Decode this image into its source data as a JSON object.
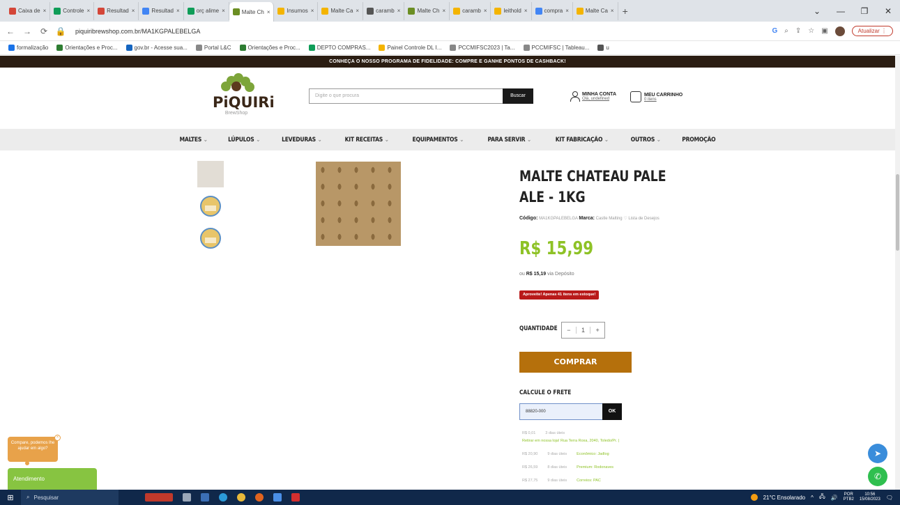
{
  "browser": {
    "tabs": [
      {
        "label": "Caixa de",
        "color": "#d44638"
      },
      {
        "label": "Controle",
        "color": "#0f9d58"
      },
      {
        "label": "Resultad",
        "color": "#d44638"
      },
      {
        "label": "Resultad",
        "color": "#4285f4"
      },
      {
        "label": "orç alime",
        "color": "#0f9d58"
      },
      {
        "label": "Malte Ch",
        "color": "#6b8e23",
        "active": true
      },
      {
        "label": "Insumos",
        "color": "#f4b400"
      },
      {
        "label": "Malte Ca",
        "color": "#f4b400"
      },
      {
        "label": "caramb",
        "color": "#555555"
      },
      {
        "label": "Malte Ch",
        "color": "#6b8e23"
      },
      {
        "label": "caramb",
        "color": "#f4b400"
      },
      {
        "label": "leithold",
        "color": "#f4b400"
      },
      {
        "label": "compra",
        "color": "#4285f4"
      },
      {
        "label": "Malte Ca",
        "color": "#f4b400"
      }
    ],
    "new_tab": "+",
    "url": "piquiribrewshop.com.br/MA1KGPALEBELGA",
    "update_label": "Atualizar",
    "bookmarks": [
      {
        "label": "formalização",
        "color": "#1a73e8"
      },
      {
        "label": "Orientações e Proc...",
        "color": "#2e7d32"
      },
      {
        "label": "gov.br - Acesse sua...",
        "color": "#1565c0"
      },
      {
        "label": "Portal L&C",
        "color": "#888888"
      },
      {
        "label": "Orientações e Proc...",
        "color": "#2e7d32"
      },
      {
        "label": "DEPTO COMPRAS...",
        "color": "#0f9d58"
      },
      {
        "label": "Painel Controle DL I...",
        "color": "#f4b400"
      },
      {
        "label": "PCCMIFSC2023 | Ta...",
        "color": "#888888"
      },
      {
        "label": "PCCMIFSC | Tableau...",
        "color": "#888888"
      },
      {
        "label": "u",
        "color": "#555555"
      }
    ]
  },
  "site": {
    "promo_bar": "CONHEÇA O NOSSO PROGRAMA DE FIDELIDADE: COMPRE E GANHE PONTOS DE CASHBACK!",
    "logo_name": "PiQUIRi",
    "logo_sub": "BrewShop",
    "search_placeholder": "Digite o que procura",
    "search_button": "Buscar",
    "account_title": "MINHA CONTA",
    "account_sub": "Olá, undefined",
    "cart_title": "MEU CARRINHO",
    "cart_sub": "0 itens",
    "menu": [
      {
        "label": "MALTES",
        "caret": true
      },
      {
        "label": "LÚPULOS",
        "caret": true
      },
      {
        "label": "LEVEDURAS",
        "caret": true
      },
      {
        "label": "KIT RECEITAS",
        "caret": true
      },
      {
        "label": "EQUIPAMENTOS",
        "caret": true
      },
      {
        "label": "PARA SERVIR",
        "caret": true
      },
      {
        "label": "KIT FABRICAÇÃO",
        "caret": true
      },
      {
        "label": "OUTROS",
        "caret": true
      },
      {
        "label": "PROMOÇÃO",
        "caret": false
      }
    ]
  },
  "product": {
    "title": "MALTE CHATEAU PALE ALE - 1KG",
    "code_label": "Código:",
    "code": "MA1KGPALEBELGA",
    "brand_label": "Marca:",
    "brand": "Castle Malting",
    "wishlist": "Lista de Desejos",
    "price": "R$ 15,99",
    "price_alt_prefix": "ou",
    "price_alt": "R$ 15,19",
    "price_alt_suffix": "via Depósito",
    "stock_note": "Aproveite! Apenas 41 itens em estoque!",
    "qty_label": "QUANTIDADE",
    "qty_minus": "−",
    "qty_value": "1",
    "qty_plus": "+",
    "buy_label": "COMPRAR",
    "freight_label": "CALCULE O FRETE",
    "cep_value": "88820-000",
    "ok_label": "OK",
    "shipping": [
      {
        "price": "R$ 0,01",
        "days": "3 dias úteis",
        "service": "Retirar em nossa loja! Rua Terra Roxa, 2040, Toledo/Pr. |"
      },
      {
        "price": "R$ 20,90",
        "days": "9 dias úteis",
        "service": "Econômico: Jadlog"
      },
      {
        "price": "R$ 26,59",
        "days": "8 dias úteis",
        "service": "Premium: Rodonaves"
      },
      {
        "price": "R$ 27,75",
        "days": "9 dias úteis",
        "service": "Correios: PAC"
      }
    ]
  },
  "widgets": {
    "chat_bubble": "Compare, podemos lhe ajudar em algo?",
    "attend_label": "Atendimento"
  },
  "taskbar": {
    "search": "Pesquisar",
    "weather": "21°C Ensolarado",
    "lang": "POR",
    "lang2": "PTB2",
    "time": "10:56",
    "date": "15/08/2023"
  }
}
